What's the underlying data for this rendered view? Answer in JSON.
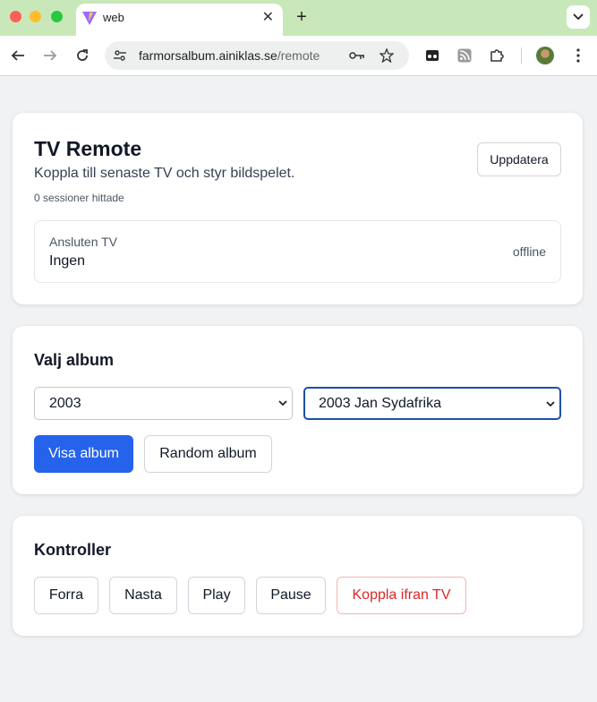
{
  "browser": {
    "tab_title": "web",
    "url_host": "farmorsalbum.ainiklas.se",
    "url_path": "/remote"
  },
  "remote": {
    "title": "TV Remote",
    "subtitle": "Koppla till senaste TV och styr bildspelet.",
    "sessions_text": "0 sessioner hittade",
    "refresh_label": "Uppdatera",
    "connected_label": "Ansluten TV",
    "connected_value": "Ingen",
    "connection_status": "offline"
  },
  "album": {
    "heading": "Valj album",
    "year_selected": "2003",
    "album_selected": "2003 Jan Sydafrika",
    "show_label": "Visa album",
    "random_label": "Random album"
  },
  "controls": {
    "heading": "Kontroller",
    "prev_label": "Forra",
    "next_label": "Nasta",
    "play_label": "Play",
    "pause_label": "Pause",
    "disconnect_label": "Koppla ifran TV"
  },
  "colors": {
    "primary": "#2563eb",
    "danger": "#dc2626",
    "tabbar": "#c9e8b9"
  }
}
